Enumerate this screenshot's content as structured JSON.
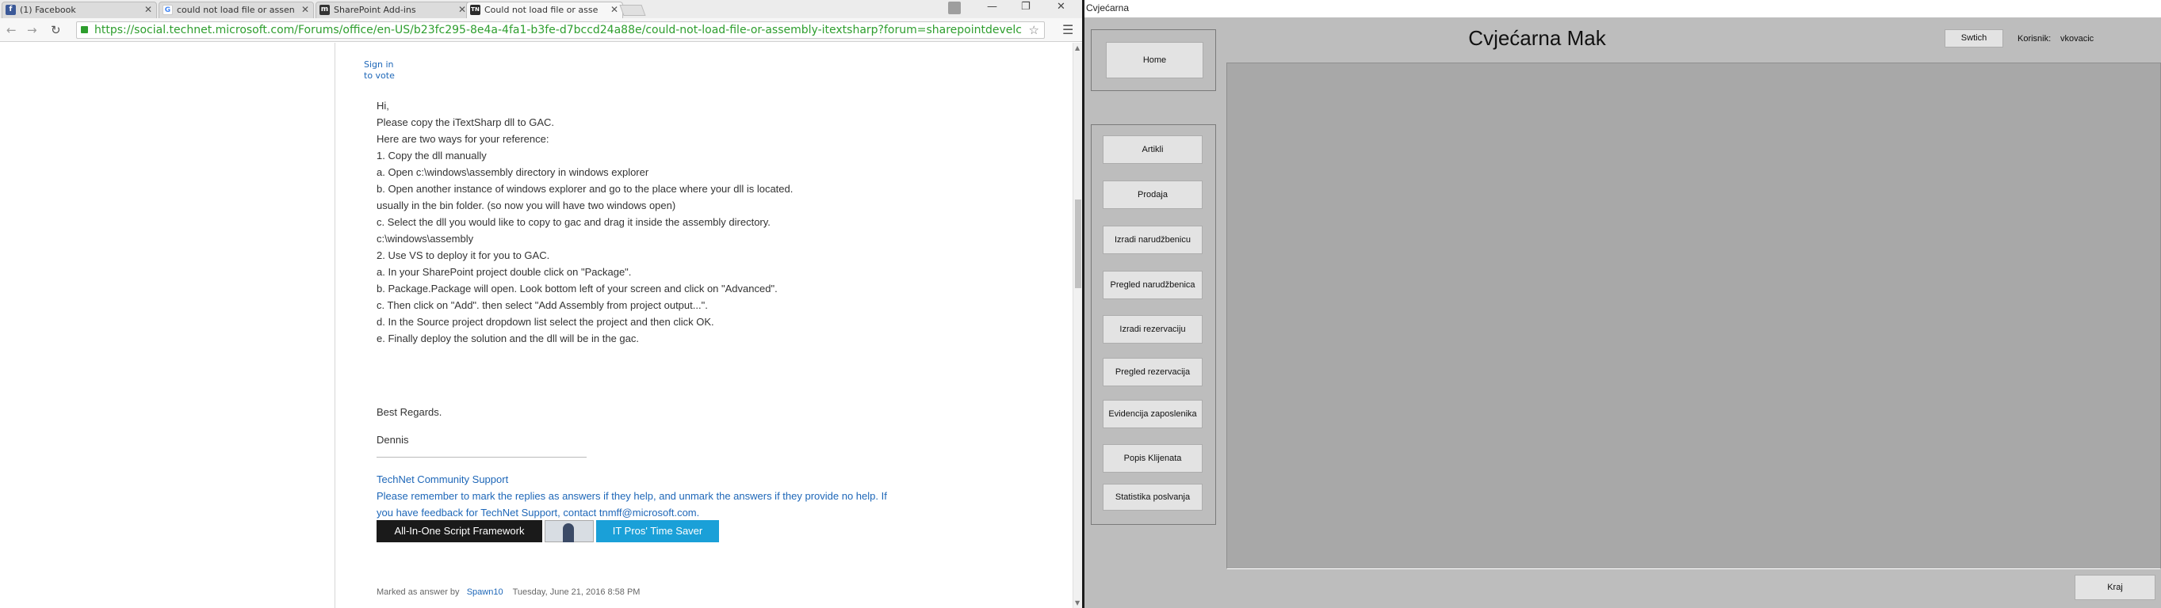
{
  "browser": {
    "tabs": [
      {
        "label": "(1) Facebook",
        "icon": "facebook-icon",
        "color": "#3b5998",
        "glyph": "f"
      },
      {
        "label": "could not load file or assen",
        "icon": "google-icon",
        "color": "#4285f4",
        "glyph": "G"
      },
      {
        "label": "SharePoint Add-ins",
        "icon": "msdn-icon",
        "color": "#333333",
        "glyph": "m"
      },
      {
        "label": "Could not load file or asse",
        "icon": "technet-icon",
        "color": "#2b2b2b",
        "glyph": "TN"
      }
    ],
    "url": "https://social.technet.microsoft.com/Forums/office/en-US/b23fc295-8e4a-4fa1-b3fe-d7bccd24a88e/could-not-load-file-or-assembly-itextsharp?forum=sharepointdevelc",
    "accent_url": "#2e9e2e"
  },
  "post": {
    "sign_in_line1": "Sign in",
    "sign_in_line2": "to vote",
    "lines": [
      "Hi,",
      "Please copy the iTextSharp dll to GAC.",
      "Here are two ways for your reference:",
      "1. Copy the dll manually",
      "a. Open c:\\windows\\assembly directory in windows explorer",
      "b. Open another instance of windows explorer and go to the place where your dll is located.",
      "usually in the bin folder. (so now you will have two windows open)",
      "c. Select the dll you would like to copy to gac and drag it inside the assembly directory.",
      "c:\\windows\\assembly",
      "2. Use VS to deploy it for you to GAC.",
      "a. In your SharePoint project double click on \"Package\".",
      "b. Package.Package will open. Look bottom left of your screen and click on \"Advanced\".",
      "c. Then click on \"Add\". then select \"Add Assembly from project output...\".",
      "d. In the Source project dropdown list select the project and then click OK.",
      "e. Finally deploy the solution and the dll will be in the gac.",
      "Best Regards.",
      "Dennis"
    ],
    "signature": [
      "TechNet Community Support",
      "Please remember to mark the replies as answers if they help, and unmark the answers if they provide no help. If",
      "you have feedback for TechNet Support, contact tnmff@microsoft.com."
    ],
    "banner_left": "All-In-One Script Framework",
    "banner_right": "IT Pros' Time Saver",
    "marked_label": "Marked as answer by",
    "marked_user": "Spawn10",
    "marked_date": "Tuesday, June 21, 2016 8:58 PM"
  },
  "app": {
    "window_title": "Cvjećarna",
    "heading": "Cvjećarna Mak",
    "switch_label": "Swtich",
    "korisnik_label": "Korisnik:",
    "korisnik_value": "vkovacic",
    "home_label": "Home",
    "menu": [
      "Artikli",
      "Prodaja",
      "Izradi narudžbenicu",
      "Pregled narudžbenica",
      "Izradi rezervaciju",
      "Pregled rezervacija",
      "Evidencija zaposlenika",
      "Popis Klijenata",
      "Statistika poslvanja"
    ],
    "exit_label": "Kraj"
  }
}
